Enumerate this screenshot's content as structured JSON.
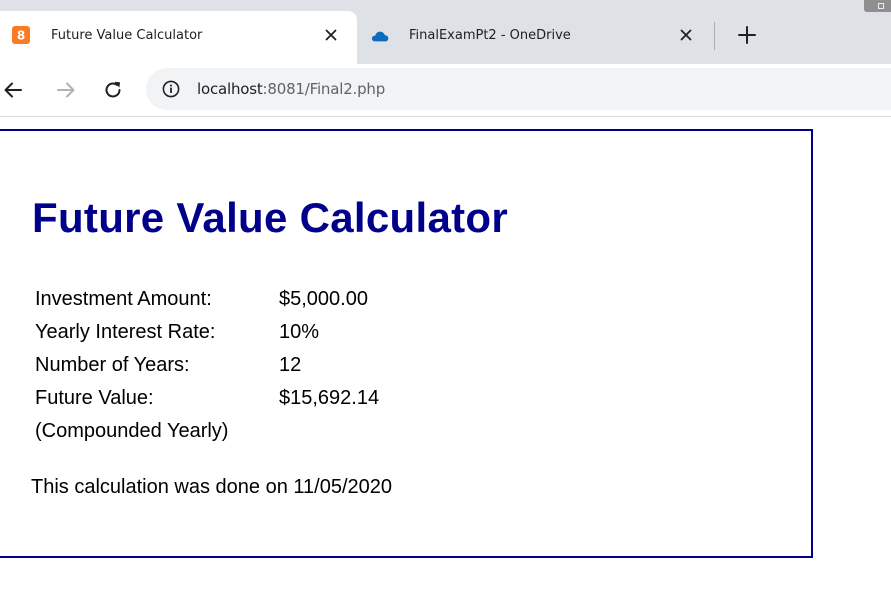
{
  "browser": {
    "tabs": [
      {
        "title": "Future Value Calculator",
        "favicon": "xampp-icon",
        "active": true
      },
      {
        "title": "FinalExamPt2 - OneDrive",
        "favicon": "onedrive-cloud-icon",
        "active": false
      }
    ],
    "address": {
      "host": "localhost",
      "rest": ":8081/Final2.php"
    }
  },
  "page": {
    "heading": "Future Value Calculator",
    "results": [
      {
        "label": "Investment Amount:",
        "value": "$5,000.00"
      },
      {
        "label": "Yearly Interest Rate:",
        "value": "10%"
      },
      {
        "label": "Number of Years:",
        "value": "12"
      },
      {
        "label": "Future Value:",
        "value": "$15,692.14"
      }
    ],
    "compounding_note": "(Compounded Yearly)",
    "date_message": "This calculation was done on 11/05/2020"
  },
  "colors": {
    "heading": "#00008b",
    "border": "#00008b",
    "tabstrip": "#dee1e6",
    "omnibox": "#f1f3f4"
  }
}
